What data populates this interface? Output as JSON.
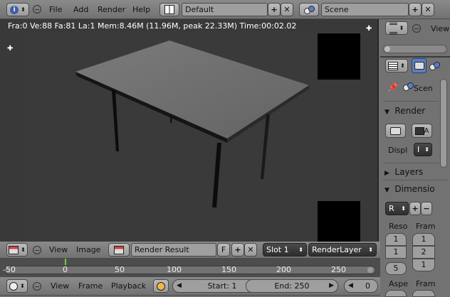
{
  "top_menu": {
    "items": [
      "File",
      "Add",
      "Render",
      "Help"
    ],
    "layout_name": "Default",
    "scene_name": "Scene"
  },
  "viewport": {
    "stats": "Fra:0  Ve:88 Fa:81 La:1 Mem:8.46M (11.96M, peak 22.33M) Time:00:02.02"
  },
  "image_editor_header": {
    "items": [
      "View",
      "Image"
    ],
    "image_name": "Render Result",
    "f_label": "F",
    "slot": "Slot 1",
    "render_layer": "RenderLayer"
  },
  "timeline_ruler": {
    "ticks": [
      "-50",
      "0",
      "50",
      "100",
      "150",
      "200",
      "250"
    ],
    "current_frame": 0
  },
  "timeline_header": {
    "items": [
      "View",
      "Frame",
      "Playback"
    ],
    "start": "Start: 1",
    "end": "End: 250",
    "current": "0"
  },
  "outliner": {
    "view_label": "View"
  },
  "properties": {
    "scene_label": "Scen",
    "sections": {
      "render": "Render",
      "layers": "Layers",
      "dimensions": "Dimensio"
    },
    "display_label": "Displ",
    "display_value": "I",
    "render_a": "A",
    "preset_value": "R",
    "resolution_label": "Reso",
    "frame_label": "Fram",
    "res_x": "1",
    "res_y": "1",
    "res_pct": "5",
    "frame_start": "1",
    "frame_end": "2",
    "frame_step": "1",
    "aspect_label": "Aspe",
    "frame_rate_label": "Fram"
  },
  "colors": {
    "accent_blue": "#5a7fc4",
    "viewport_bg": "#393939",
    "current_frame_line": "#6ccf3a"
  }
}
